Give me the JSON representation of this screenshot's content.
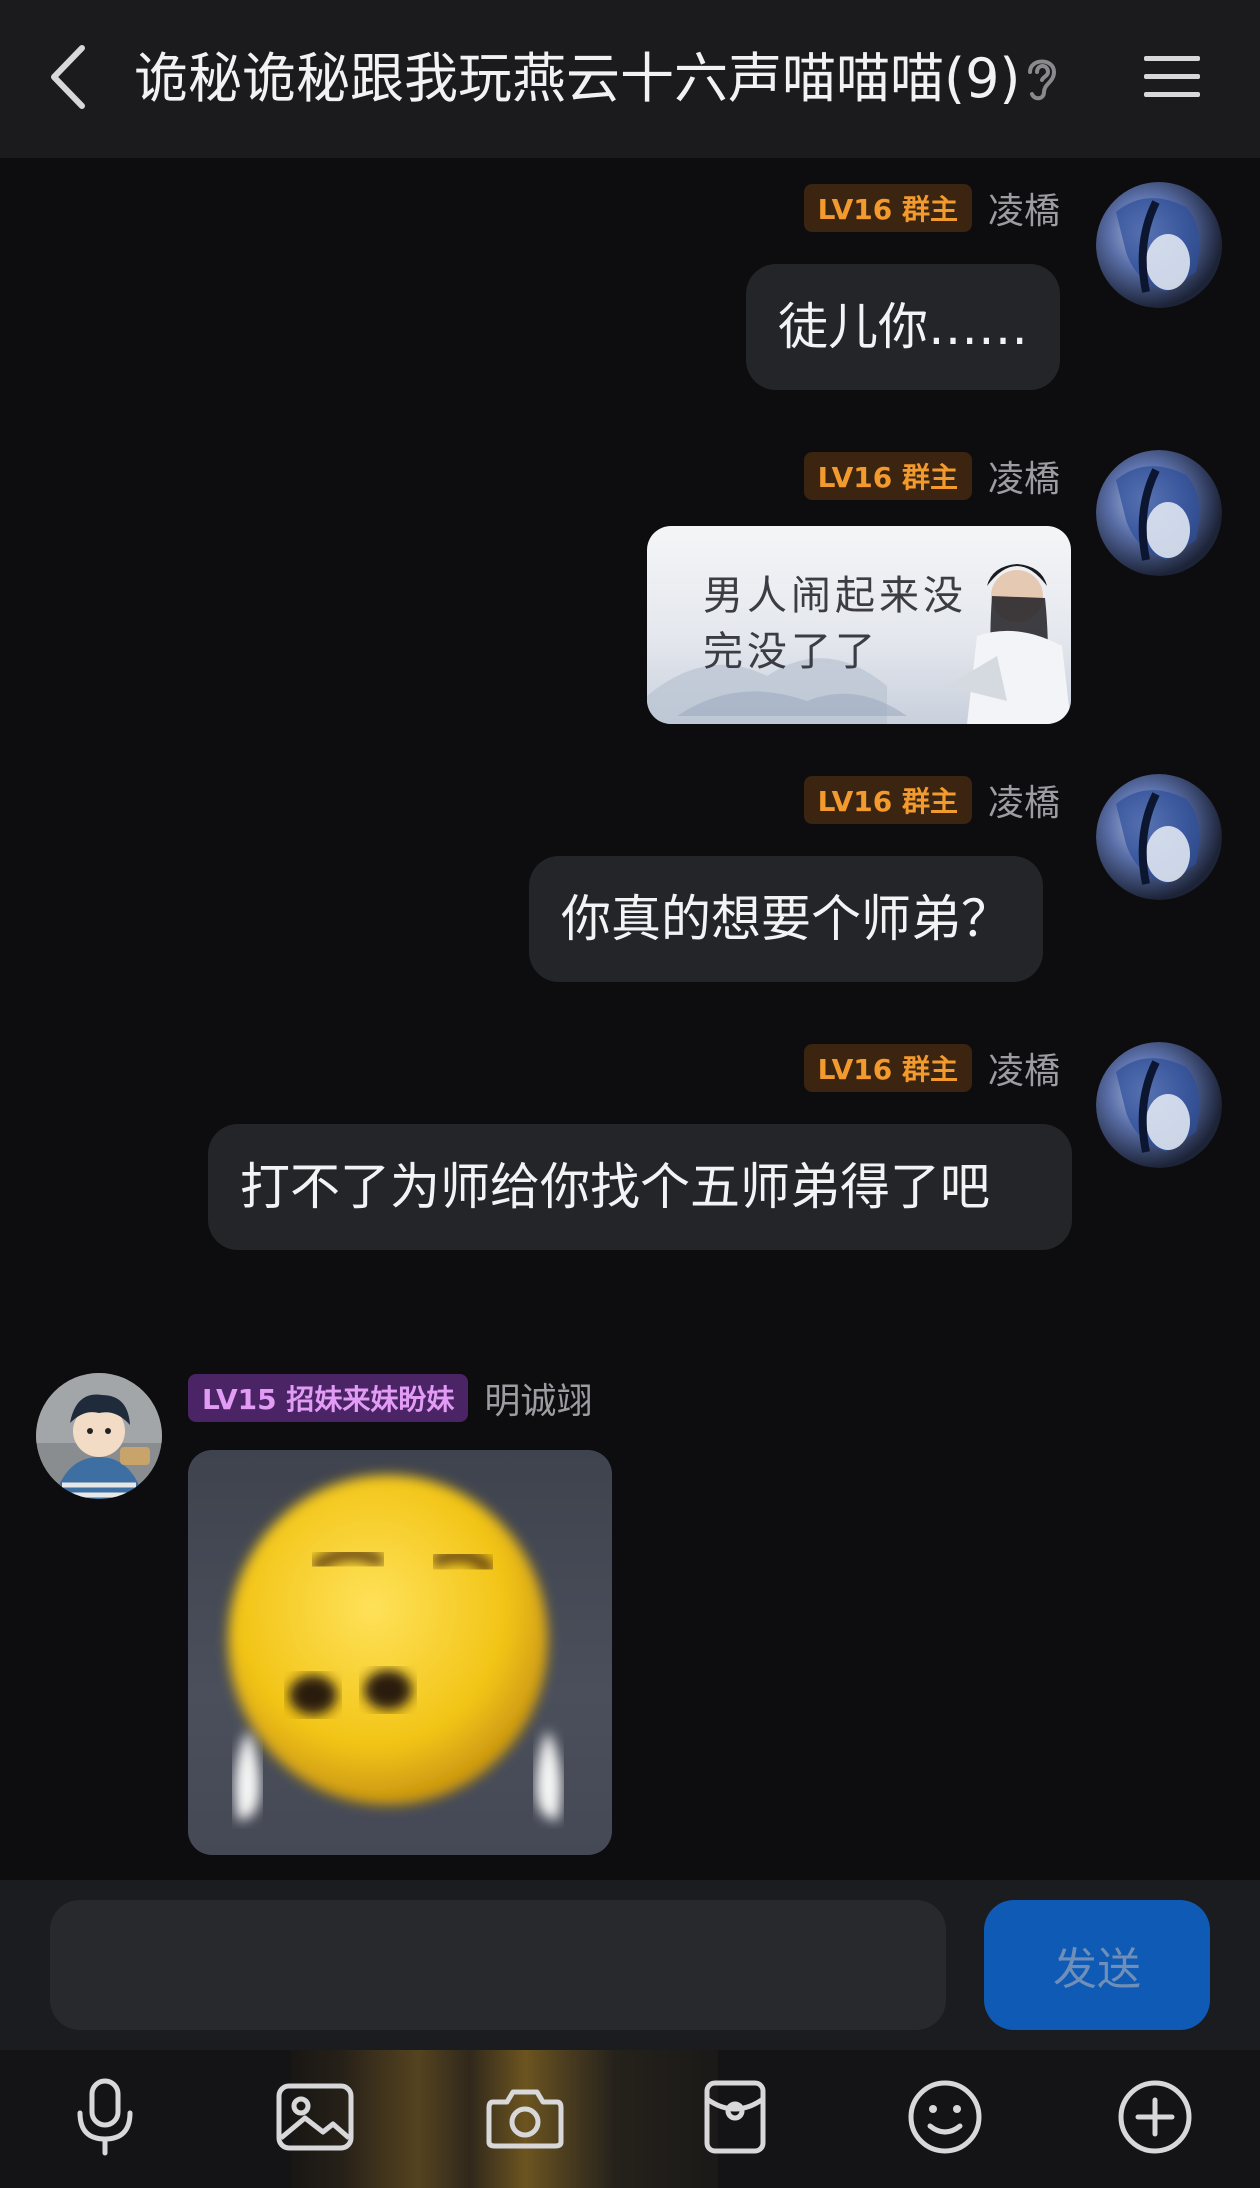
{
  "header": {
    "title": "诡秘诡秘跟我玩燕云十六声喵喵喵(9)"
  },
  "messages": [
    {
      "sender": "凌橋",
      "badge": "LV16 群主",
      "type": "text",
      "text": "徒儿你……"
    },
    {
      "sender": "凌橋",
      "badge": "LV16 群主",
      "type": "image",
      "image_text": "男人闹起来没完没了了"
    },
    {
      "sender": "凌橋",
      "badge": "LV16 群主",
      "type": "text",
      "text": "你真的想要个师弟？"
    },
    {
      "sender": "凌橋",
      "badge": "LV16 群主",
      "type": "text",
      "text": "打不了为师给你找个五师弟得了吧"
    },
    {
      "sender": "明诚翊",
      "badge": "LV15 招妹来妹盼妹",
      "type": "image",
      "image_text": ""
    }
  ],
  "image_caption": {
    "line1": "男人闹起来没",
    "line2": "完没了了"
  },
  "input": {
    "value": "",
    "placeholder": "",
    "send_label": "发送"
  },
  "toolbar": {
    "icons": [
      "microphone-icon",
      "image-icon",
      "camera-icon",
      "red-packet-icon",
      "emoji-icon",
      "plus-icon"
    ]
  },
  "colors": {
    "background": "#0d0d0f",
    "header": "#1b1b1d",
    "bubble": "#232529",
    "owner_badge_text": "#f29a2e",
    "member_badge_text": "#e39cf6",
    "send_button": "#0e5ab4"
  }
}
